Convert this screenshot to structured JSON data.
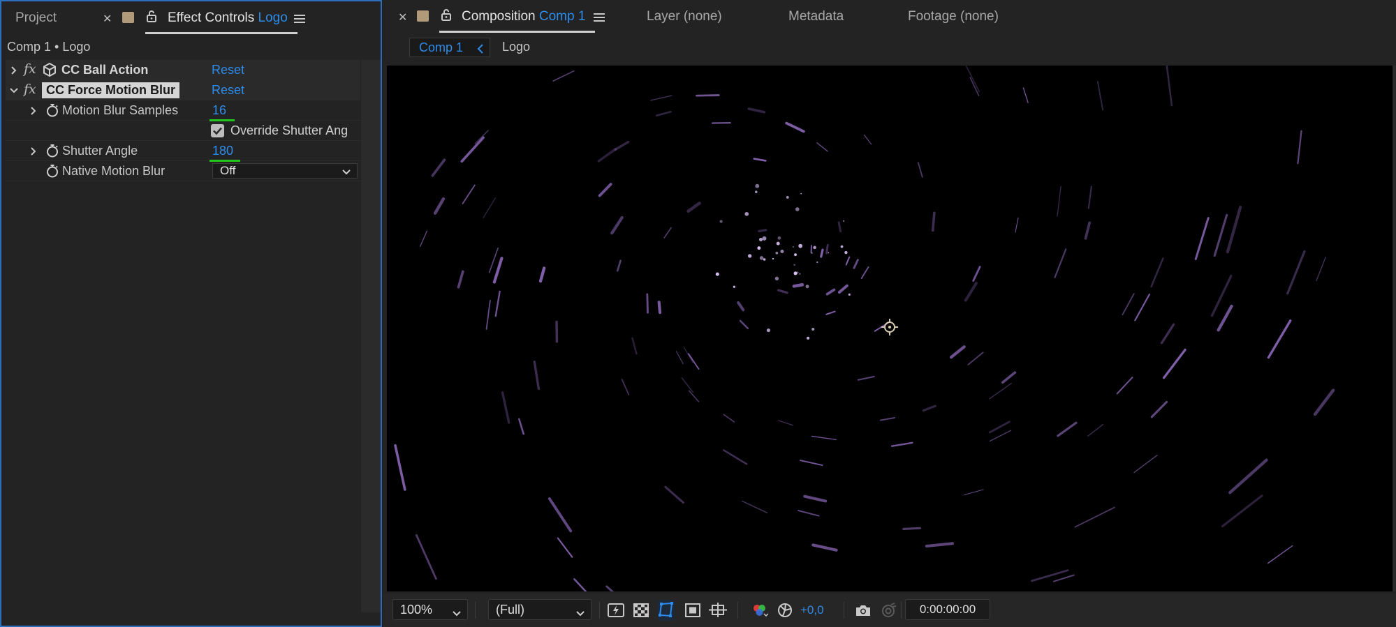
{
  "left_panel": {
    "tabs": {
      "project": "Project",
      "effect_controls": "Effect Controls",
      "effect_controls_layer": "Logo"
    },
    "breadcrumb": "Comp 1 • Logo",
    "effects": [
      {
        "name": "CC Ball Action",
        "fx": "fx",
        "reset": "Reset"
      },
      {
        "name": "CC Force Motion Blur",
        "fx": "fx",
        "reset": "Reset"
      }
    ],
    "params": {
      "motion_blur_samples": {
        "label": "Motion Blur Samples",
        "value": "16"
      },
      "override_shutter": {
        "label": "Override Shutter Ang",
        "checked": true
      },
      "shutter_angle": {
        "label": "Shutter Angle",
        "value": "180"
      },
      "native_motion_blur": {
        "label": "Native Motion Blur",
        "value": "Off"
      }
    }
  },
  "right_panel": {
    "tabs": {
      "composition": "Composition",
      "composition_name": "Comp 1",
      "layer": "Layer",
      "layer_value": "(none)",
      "metadata": "Metadata",
      "footage": "Footage",
      "footage_value": "(none)"
    },
    "nav": {
      "comp": "Comp 1",
      "layer": "Logo"
    },
    "viewer_bar": {
      "zoom": "100%",
      "resolution": "(Full)",
      "exposure": "+0,0",
      "timecode": "0:00:00:00"
    }
  },
  "colors": {
    "accent_blue": "#2d8ceb",
    "highlight_green": "#22c51b",
    "panel_border": "#2d6fbf",
    "particle_purple": "#a57ad8"
  }
}
